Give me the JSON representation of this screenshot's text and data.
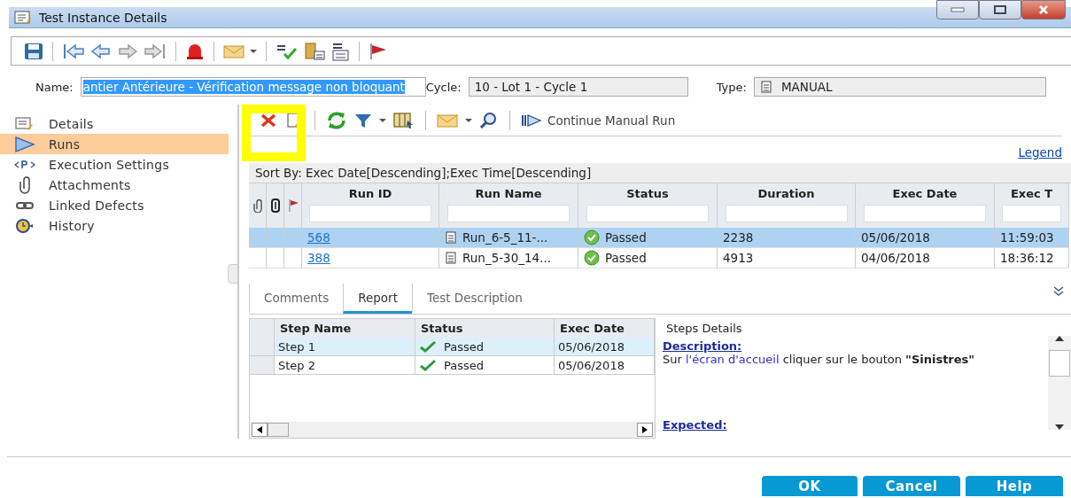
{
  "window": {
    "title": "Test Instance Details"
  },
  "fields": [
    {
      "kind": "name",
      "label": "Name:",
      "value": "antier Antérieure - Vérification message non bloquant",
      "highlighted": true
    },
    {
      "kind": "cycle",
      "label": "Cycle:",
      "value": "10 - Lot 1 - Cycle 1",
      "highlighted": false
    },
    {
      "kind": "type",
      "label": "Type:",
      "value": "MANUAL",
      "highlighted": false
    }
  ],
  "sidebar": {
    "items": [
      {
        "label": "Details",
        "selected": false
      },
      {
        "label": "Runs",
        "selected": true
      },
      {
        "label": "Execution Settings",
        "selected": false
      },
      {
        "label": "Attachments",
        "selected": false
      },
      {
        "label": "Linked Defects",
        "selected": false
      },
      {
        "label": "History",
        "selected": false
      }
    ]
  },
  "runs_toolbar": {
    "continue_label": "Continue Manual Run"
  },
  "legend_link": "Legend",
  "sort_by": "Sort By: Exec Date[Descending];Exec Time[Descending]",
  "runs_table": {
    "columns": [
      "Run ID",
      "Run Name",
      "Status",
      "Duration",
      "Exec Date",
      "Exec T"
    ],
    "rows": [
      {
        "run_id": "568",
        "run_name": "Run_6-5_11-...",
        "status": "Passed",
        "duration": "2238",
        "exec_date": "05/06/2018",
        "exec_time": "11:59:03",
        "selected": true
      },
      {
        "run_id": "388",
        "run_name": "Run_5-30_14...",
        "status": "Passed",
        "duration": "4913",
        "exec_date": "04/06/2018",
        "exec_time": "18:36:12",
        "selected": false
      }
    ]
  },
  "tabs": [
    {
      "label": "Comments",
      "selected": false
    },
    {
      "label": "Report",
      "selected": true
    },
    {
      "label": "Test Description",
      "selected": false
    }
  ],
  "steps_table": {
    "columns": [
      "Step Name",
      "Status",
      "Exec Date"
    ],
    "rows": [
      {
        "name": "Step 1",
        "status": "Passed",
        "exec_date": "05/06/2018",
        "selected": true
      },
      {
        "name": "Step 2",
        "status": "Passed",
        "exec_date": "05/06/2018",
        "selected": false
      }
    ]
  },
  "steps_details": {
    "title": "Steps Details",
    "description_label": "Description:",
    "description": [
      {
        "kind": "plain",
        "text": "Sur "
      },
      {
        "kind": "link",
        "text": "l'écran d'accueil"
      },
      {
        "kind": "plain",
        "text": " cliquer sur le bouton "
      },
      {
        "kind": "bold",
        "text": "\"Sinistres\""
      }
    ],
    "expected_label": "Expected:"
  },
  "buttons": [
    "OK",
    "Cancel",
    "Help"
  ]
}
